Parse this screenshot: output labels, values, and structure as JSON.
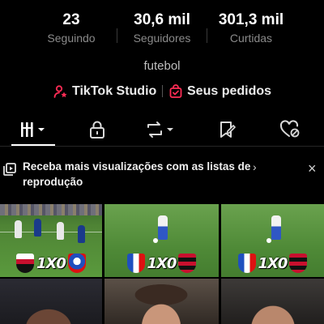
{
  "profile": {
    "stats": [
      {
        "value": "23",
        "label": "Seguindo"
      },
      {
        "value": "30,6 mil",
        "label": "Seguidores"
      },
      {
        "value": "301,3 mil",
        "label": "Curtidas"
      }
    ],
    "bio": "futebol",
    "links": {
      "studio": "TikTok Studio",
      "orders": "Seus pedidos"
    }
  },
  "tabs": [
    {
      "icon": "grid-icon",
      "active": true
    },
    {
      "icon": "lock-icon",
      "active": false
    },
    {
      "icon": "repost-icon",
      "active": false
    },
    {
      "icon": "bookmark-icon",
      "active": false
    },
    {
      "icon": "liked-heart-icon",
      "active": false
    }
  ],
  "banner": {
    "text": "Receba mais visualizações com as listas de reprodução",
    "chevron": "›",
    "close": "×"
  },
  "videos": [
    {
      "score": "1X0"
    },
    {
      "score": "1X0"
    },
    {
      "score": "1X0"
    }
  ],
  "colors": {
    "background": "#000000",
    "accent_red": "#fe2c55",
    "muted_text": "#8a8a8a"
  }
}
